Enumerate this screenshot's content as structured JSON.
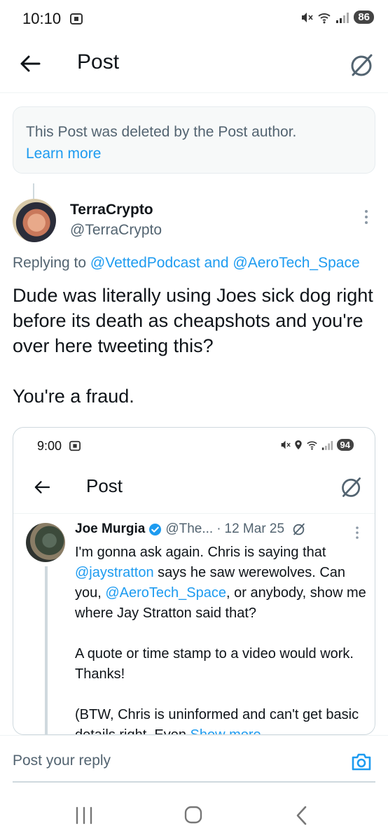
{
  "status_bar": {
    "time": "10:10",
    "battery": "86"
  },
  "header": {
    "title": "Post"
  },
  "deleted_notice": {
    "text": "This Post was deleted by the Post author.",
    "link": "Learn more"
  },
  "tweet": {
    "author_name": "TerraCrypto",
    "author_handle": "@TerraCrypto",
    "replying_prefix": "Replying to ",
    "replying_user1": "@VettedPodcast",
    "replying_and": " and ",
    "replying_user2": "@AeroTech_Space",
    "text_p1": "Dude was literally using Joes sick dog right before its death as cheapshots and you're over here tweeting this?",
    "text_p2": "You're a fraud."
  },
  "embedded": {
    "status_time": "9:00",
    "battery": "94",
    "title": "Post",
    "author_name": "Joe Murgia",
    "author_handle": "@The...",
    "dot": "·",
    "date": "12 Mar 25",
    "p1_a": "I'm gonna ask again. Chris is saying that ",
    "p1_mention1": "@jaystratton",
    "p1_b": " says he saw werewolves. Can you, ",
    "p1_mention2": "@AeroTech_Space",
    "p1_c": ", or anybody, show me where Jay Stratton said that?",
    "p2": "A quote or time stamp to a video would work. Thanks!",
    "p3_a": "(BTW, Chris is uninformed and can't get basic details right. Even ",
    "show_more": "Show more"
  },
  "reply": {
    "placeholder": "Post your reply"
  },
  "colors": {
    "accent": "#1d9bf0",
    "secondary_text": "#536471",
    "verified": "#1d9bf0"
  }
}
